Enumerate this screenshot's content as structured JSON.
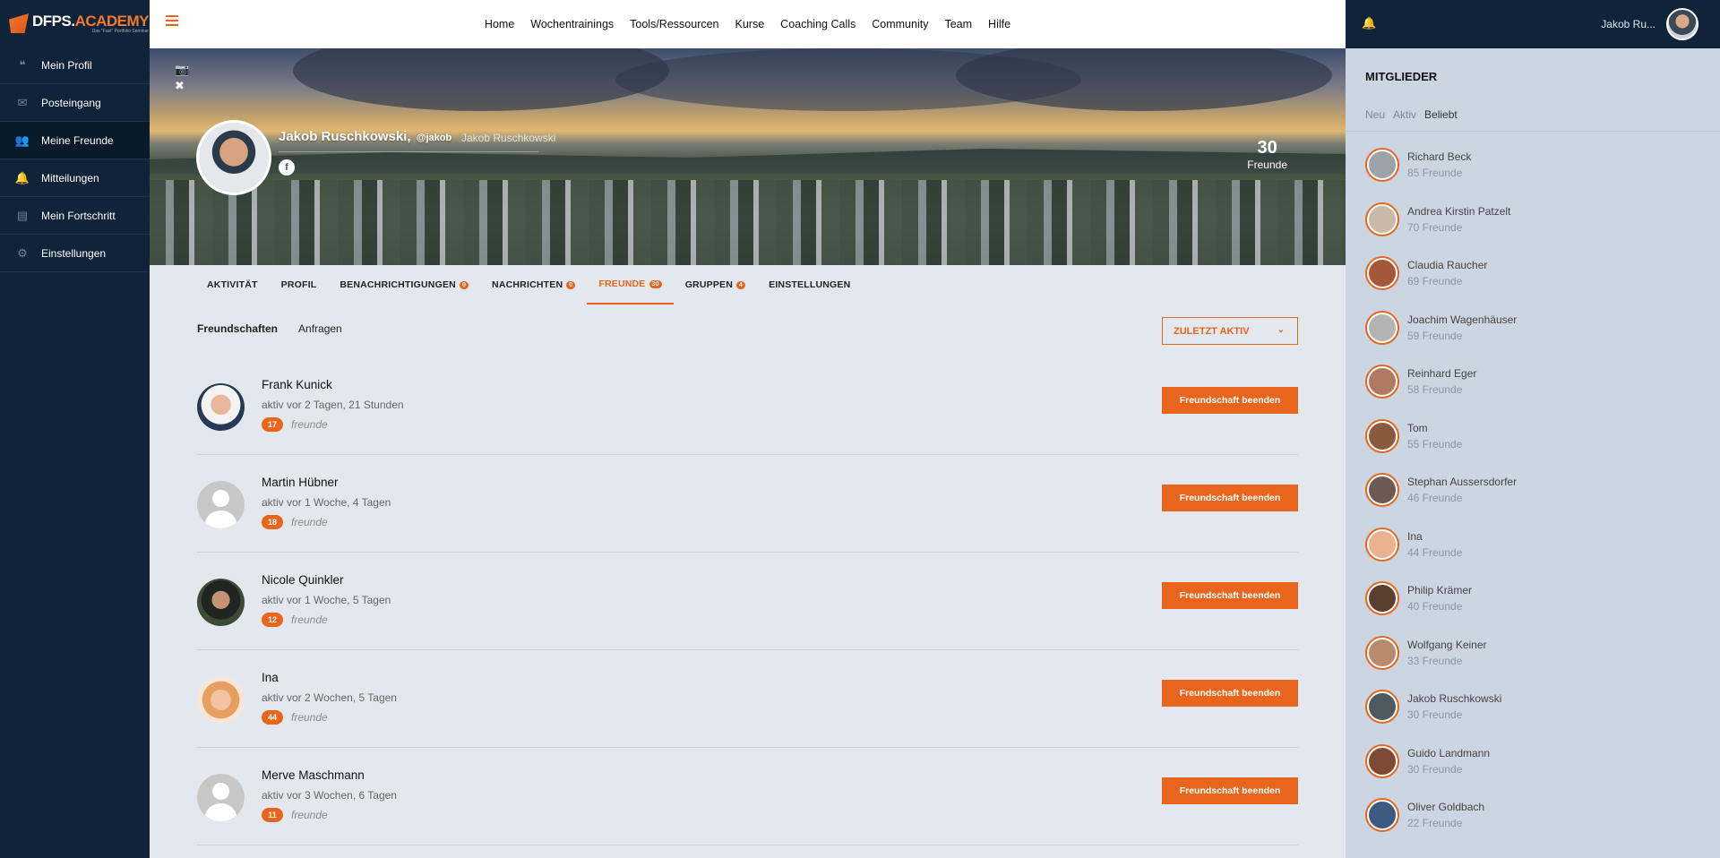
{
  "logo": {
    "main": "DFPS.",
    "accent": "ACADEMY",
    "tagline": "Das \"Fast\" Portfolio Seminar"
  },
  "sidebar": {
    "items": [
      {
        "label": "Mein Profil",
        "icon": "quote-icon"
      },
      {
        "label": "Posteingang",
        "icon": "envelope-icon"
      },
      {
        "label": "Meine Freunde",
        "icon": "users-icon"
      },
      {
        "label": "Mitteilungen",
        "icon": "bell-icon"
      },
      {
        "label": "Mein Fortschritt",
        "icon": "file-icon"
      },
      {
        "label": "Einstellungen",
        "icon": "gears-icon"
      }
    ]
  },
  "topnav": {
    "items": [
      "Home",
      "Wochentrainings",
      "Tools/Ressourcen",
      "Kurse",
      "Coaching Calls",
      "Community",
      "Team",
      "Hilfe"
    ]
  },
  "user": {
    "name": "Jakob Ru..."
  },
  "profile": {
    "name": "Jakob Ruschkowski,",
    "handle": "@jakob",
    "fullname": "Jakob Ruschkowski",
    "friends_count": "30",
    "friends_label": "Freunde"
  },
  "tabs": [
    {
      "label": "AKTIVITÄT",
      "badge": ""
    },
    {
      "label": "PROFIL",
      "badge": ""
    },
    {
      "label": "BENACHRICHTIGUNGEN",
      "badge": "0"
    },
    {
      "label": "NACHRICHTEN",
      "badge": "0"
    },
    {
      "label": "FREUNDE",
      "badge": "30"
    },
    {
      "label": "GRUPPEN",
      "badge": "4"
    },
    {
      "label": "EINSTELLUNGEN",
      "badge": ""
    }
  ],
  "subtabs": {
    "friendships": "Freundschaften",
    "requests": "Anfragen"
  },
  "sort": {
    "selected": "ZULETZT AKTIV"
  },
  "friends": [
    {
      "name": "Frank Kunick",
      "active": "aktiv vor 2 Tagen, 21 Stunden",
      "count": "17",
      "label": "freunde",
      "button": "Freundschaft beenden"
    },
    {
      "name": "Martin Hübner",
      "active": "aktiv vor 1 Woche, 4 Tagen",
      "count": "18",
      "label": "freunde",
      "button": "Freundschaft beenden"
    },
    {
      "name": "Nicole Quinkler",
      "active": "aktiv vor 1 Woche, 5 Tagen",
      "count": "12",
      "label": "freunde",
      "button": "Freundschaft beenden"
    },
    {
      "name": "Ina",
      "active": "aktiv vor 2 Wochen, 5 Tagen",
      "count": "44",
      "label": "freunde",
      "button": "Freundschaft beenden"
    },
    {
      "name": "Merve Maschmann",
      "active": "aktiv vor 3 Wochen, 6 Tagen",
      "count": "11",
      "label": "freunde",
      "button": "Freundschaft beenden"
    }
  ],
  "members": {
    "title": "MITGLIEDER",
    "tabs": [
      "Neu",
      "Aktiv",
      "Beliebt"
    ],
    "list": [
      {
        "name": "Richard Beck",
        "count": "85 Freunde"
      },
      {
        "name": "Andrea Kirstin Patzelt",
        "count": "70 Freunde"
      },
      {
        "name": "Claudia Raucher",
        "count": "69 Freunde"
      },
      {
        "name": "Joachim Wagenhäuser",
        "count": "59 Freunde"
      },
      {
        "name": "Reinhard Eger",
        "count": "58 Freunde"
      },
      {
        "name": "Tom",
        "count": "55 Freunde"
      },
      {
        "name": "Stephan Aussersdorfer",
        "count": "46 Freunde"
      },
      {
        "name": "Ina",
        "count": "44 Freunde"
      },
      {
        "name": "Philip Krämer",
        "count": "40 Freunde"
      },
      {
        "name": "Wolfgang Keiner",
        "count": "33 Freunde"
      },
      {
        "name": "Jakob Ruschkowski",
        "count": "30 Freunde"
      },
      {
        "name": "Guido Landmann",
        "count": "30 Freunde"
      },
      {
        "name": "Oliver Goldbach",
        "count": "22 Freunde"
      }
    ]
  },
  "colors": {
    "accent": "#e8651b",
    "sidebar": "#0f2339",
    "panel": "#ccd6e2"
  }
}
